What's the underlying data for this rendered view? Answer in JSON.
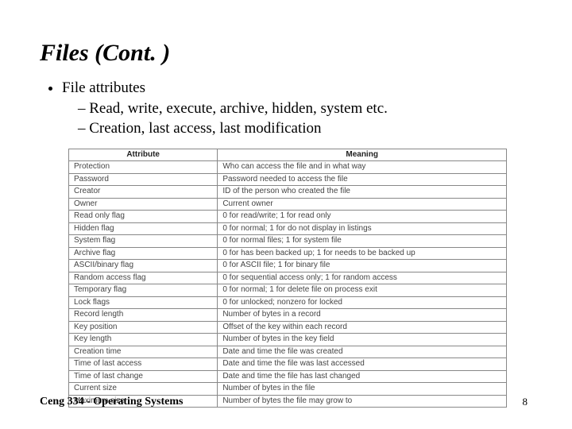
{
  "title": "Files (Cont. )",
  "bullets": {
    "top": "File attributes",
    "sub1": "Read, write, execute, archive, hidden, system etc.",
    "sub2": "Creation, last access, last modification"
  },
  "table": {
    "headers": {
      "attr": "Attribute",
      "meaning": "Meaning"
    },
    "rows": [
      {
        "attr": "Protection",
        "meaning": "Who can access the file and in what way"
      },
      {
        "attr": "Password",
        "meaning": "Password needed to access the file"
      },
      {
        "attr": "Creator",
        "meaning": "ID of the person who created the file"
      },
      {
        "attr": "Owner",
        "meaning": "Current owner"
      },
      {
        "attr": "Read only flag",
        "meaning": "0 for read/write; 1 for read only"
      },
      {
        "attr": "Hidden flag",
        "meaning": "0 for normal; 1 for do not display in listings"
      },
      {
        "attr": "System flag",
        "meaning": "0 for normal files; 1 for system file"
      },
      {
        "attr": "Archive flag",
        "meaning": "0 for has been backed up; 1 for needs to be backed up"
      },
      {
        "attr": "ASCII/binary flag",
        "meaning": "0 for ASCII file; 1 for binary file"
      },
      {
        "attr": "Random access flag",
        "meaning": "0 for sequential access only; 1 for random access"
      },
      {
        "attr": "Temporary flag",
        "meaning": "0 for normal; 1 for delete file on process exit"
      },
      {
        "attr": "Lock flags",
        "meaning": "0 for unlocked; nonzero for locked"
      },
      {
        "attr": "Record length",
        "meaning": "Number of bytes in a record"
      },
      {
        "attr": "Key position",
        "meaning": "Offset of the key within each record"
      },
      {
        "attr": "Key length",
        "meaning": "Number of bytes in the key field"
      },
      {
        "attr": "Creation time",
        "meaning": "Date and time the file was created"
      },
      {
        "attr": "Time of last access",
        "meaning": "Date and time the file was last accessed"
      },
      {
        "attr": "Time of last change",
        "meaning": "Date and time the file has last changed"
      },
      {
        "attr": "Current size",
        "meaning": "Number of bytes in the file"
      },
      {
        "attr": "Maximum size",
        "meaning": "Number of bytes the file may grow to"
      }
    ]
  },
  "footer": "Ceng 334 - Operating Systems",
  "page_number": "8"
}
